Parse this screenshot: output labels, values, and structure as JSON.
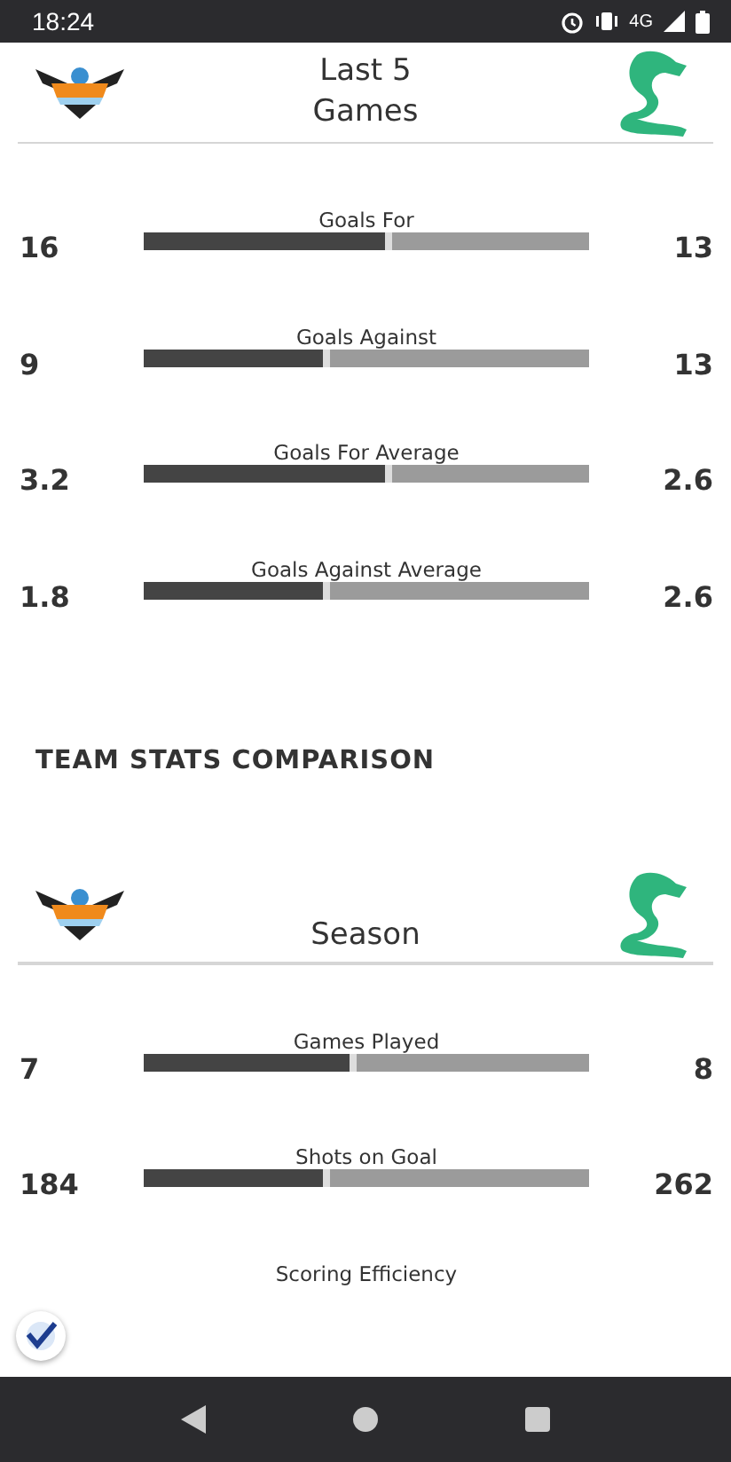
{
  "status_bar": {
    "time": "18:24",
    "network": "4G"
  },
  "sections": [
    {
      "kind": "comparison",
      "title": "Last 5 Games",
      "stats": [
        {
          "label": "Goals For",
          "home": "16",
          "away": "13",
          "level": 0.55
        },
        {
          "label": "Goals Against",
          "home": "9",
          "away": "13",
          "level": 0.41
        },
        {
          "label": "Goals For Average",
          "home": "3.2",
          "away": "2.6",
          "level": 0.55
        },
        {
          "label": "Goals Against Average",
          "home": "1.8",
          "away": "2.6",
          "level": 0.41
        }
      ]
    },
    {
      "kind": "heading",
      "title": "TEAM STATS COMPARISON"
    },
    {
      "kind": "comparison",
      "title": "Season",
      "stats": [
        {
          "label": "Games Played",
          "home": "7",
          "away": "8",
          "level": 0.47
        },
        {
          "label": "Shots on Goal",
          "home": "184",
          "away": "262",
          "level": 0.41
        },
        {
          "label": "Scoring Efficiency"
        }
      ]
    }
  ]
}
